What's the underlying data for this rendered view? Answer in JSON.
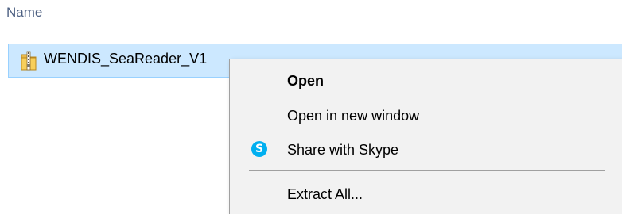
{
  "columns": {
    "name_header": "Name"
  },
  "file": {
    "name": "WENDIS_SeaReader_V1",
    "icon": "zip-folder-icon"
  },
  "context_menu": {
    "items": [
      {
        "label": "Open",
        "default": true
      },
      {
        "label": "Open in new window"
      },
      {
        "label": "Share with Skype",
        "icon": "skype-icon",
        "icon_glyph": "S"
      },
      {
        "label": "Extract All..."
      }
    ]
  },
  "colors": {
    "selection_background": "#cce8ff",
    "selection_border": "#99d1ff",
    "menu_background": "#f2f2f2",
    "header_text": "#4d6082",
    "skype_brand": "#00aff0"
  }
}
